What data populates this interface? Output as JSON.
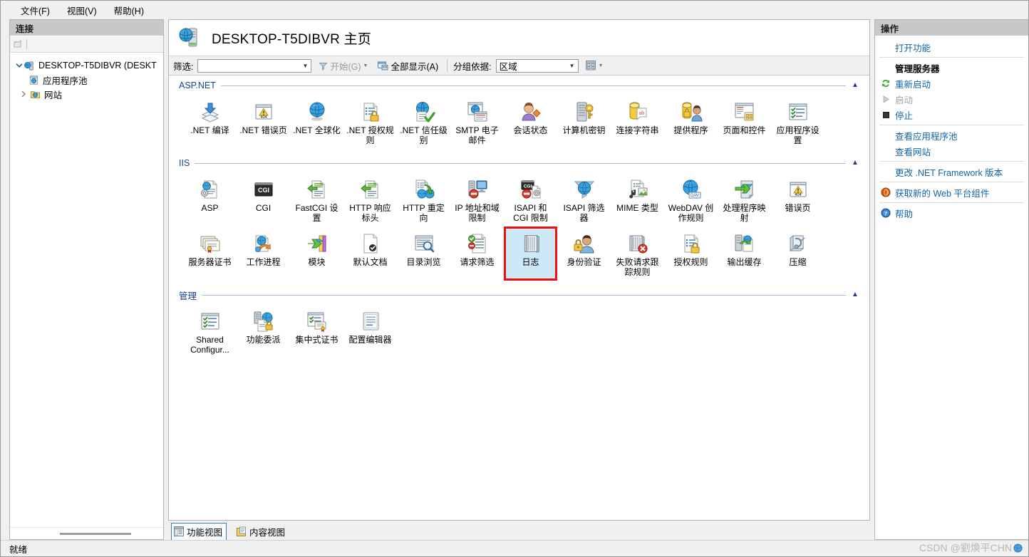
{
  "menubar": {
    "items": [
      {
        "label": "文件(F)",
        "name": "menu-file"
      },
      {
        "label": "视图(V)",
        "name": "menu-view"
      },
      {
        "label": "帮助(H)",
        "name": "menu-help"
      }
    ]
  },
  "connections": {
    "header": "连接",
    "tree": [
      {
        "label": "DESKTOP-T5DIBVR (DESKT",
        "level": 0,
        "expanded": true,
        "icon": "server-icon"
      },
      {
        "label": "应用程序池",
        "level": 1,
        "expanded": null,
        "icon": "app-pool-icon"
      },
      {
        "label": "网站",
        "level": 1,
        "expanded": false,
        "icon": "sites-folder-icon"
      }
    ]
  },
  "header": {
    "title": "DESKTOP-T5DIBVR 主页",
    "icon": "server-home-icon"
  },
  "toolbar": {
    "filter_label": "筛选:",
    "filter_value": "",
    "start_label": "开始(G)",
    "show_all_label": "全部显示(A)",
    "group_by_label": "分组依据:",
    "group_by_value": "区域",
    "view_mode_icon": "details-view-icon"
  },
  "groups": [
    {
      "name": "ASP.NET",
      "tiles": [
        {
          "label": ".NET 编译",
          "icon": "net-compilation-icon"
        },
        {
          "label": ".NET 错误页",
          "icon": "net-error-pages-icon"
        },
        {
          "label": ".NET 全球化",
          "icon": "net-globalization-icon"
        },
        {
          "label": ".NET 授权规则",
          "icon": "net-authorization-rules-icon"
        },
        {
          "label": ".NET 信任级别",
          "icon": "net-trust-levels-icon"
        },
        {
          "label": "SMTP 电子邮件",
          "icon": "smtp-email-icon"
        },
        {
          "label": "会话状态",
          "icon": "session-state-icon"
        },
        {
          "label": "计算机密钥",
          "icon": "machine-key-icon"
        },
        {
          "label": "连接字符串",
          "icon": "connection-strings-icon"
        },
        {
          "label": "提供程序",
          "icon": "providers-icon"
        },
        {
          "label": "页面和控件",
          "icon": "pages-and-controls-icon"
        },
        {
          "label": "应用程序设置",
          "icon": "application-settings-icon"
        }
      ]
    },
    {
      "name": "IIS",
      "tiles": [
        {
          "label": "ASP",
          "icon": "asp-icon"
        },
        {
          "label": "CGI",
          "icon": "cgi-icon"
        },
        {
          "label": "FastCGI 设置",
          "icon": "fastcgi-settings-icon"
        },
        {
          "label": "HTTP 响应标头",
          "icon": "http-response-headers-icon"
        },
        {
          "label": "HTTP 重定向",
          "icon": "http-redirect-icon"
        },
        {
          "label": "IP 地址和域限制",
          "icon": "ip-address-domain-restrictions-icon"
        },
        {
          "label": "ISAPI 和 CGI 限制",
          "icon": "isapi-cgi-restrictions-icon"
        },
        {
          "label": "ISAPI 筛选器",
          "icon": "isapi-filters-icon"
        },
        {
          "label": "MIME 类型",
          "icon": "mime-types-icon"
        },
        {
          "label": "WebDAV 创作规则",
          "icon": "webdav-authoring-rules-icon"
        },
        {
          "label": "处理程序映射",
          "icon": "handler-mappings-icon"
        },
        {
          "label": "错误页",
          "icon": "error-pages-icon"
        },
        {
          "label": "服务器证书",
          "icon": "server-certificates-icon"
        },
        {
          "label": "工作进程",
          "icon": "worker-processes-icon"
        },
        {
          "label": "模块",
          "icon": "modules-icon"
        },
        {
          "label": "默认文档",
          "icon": "default-document-icon"
        },
        {
          "label": "目录浏览",
          "icon": "directory-browsing-icon"
        },
        {
          "label": "请求筛选",
          "icon": "request-filtering-icon"
        },
        {
          "label": "日志",
          "icon": "logging-icon",
          "selected": true
        },
        {
          "label": "身份验证",
          "icon": "authentication-icon"
        },
        {
          "label": "失败请求跟踪规则",
          "icon": "failed-request-tracing-rules-icon"
        },
        {
          "label": "授权规则",
          "icon": "authorization-rules-icon"
        },
        {
          "label": "输出缓存",
          "icon": "output-caching-icon"
        },
        {
          "label": "压缩",
          "icon": "compression-icon"
        }
      ]
    },
    {
      "name": "管理",
      "tiles": [
        {
          "label": "Shared Configur...",
          "icon": "shared-configuration-icon"
        },
        {
          "label": "功能委派",
          "icon": "feature-delegation-icon"
        },
        {
          "label": "集中式证书",
          "icon": "centralized-certificates-icon"
        },
        {
          "label": "配置编辑器",
          "icon": "configuration-editor-icon"
        }
      ]
    }
  ],
  "view_tabs": [
    {
      "label": "功能视图",
      "icon": "features-view-icon",
      "active": true
    },
    {
      "label": "内容视图",
      "icon": "content-view-icon",
      "active": false
    }
  ],
  "actions": {
    "header": "操作",
    "items": [
      {
        "label": "打开功能",
        "style": "link",
        "indent": true,
        "icon": null,
        "name": "action-open-feature"
      },
      {
        "separator": true
      },
      {
        "label": "管理服务器",
        "style": "bold",
        "indent": true,
        "icon": null,
        "name": "action-manage-server"
      },
      {
        "label": "重新启动",
        "style": "link",
        "icon": "restart-icon",
        "name": "action-restart"
      },
      {
        "label": "启动",
        "style": "disabled",
        "icon": "start-icon",
        "name": "action-start"
      },
      {
        "label": "停止",
        "style": "link",
        "icon": "stop-icon",
        "name": "action-stop"
      },
      {
        "separator": true
      },
      {
        "label": "查看应用程序池",
        "style": "link",
        "indent": true,
        "icon": null,
        "name": "action-view-app-pools"
      },
      {
        "label": "查看网站",
        "style": "link",
        "indent": true,
        "icon": null,
        "name": "action-view-sites"
      },
      {
        "separator": true
      },
      {
        "label": "更改 .NET Framework 版本",
        "style": "link",
        "indent": true,
        "icon": null,
        "name": "action-change-dotnet-version"
      },
      {
        "separator": true
      },
      {
        "label": "获取新的 Web 平台组件",
        "style": "link",
        "icon": "web-platform-icon",
        "name": "action-get-web-platform"
      },
      {
        "separator": true
      },
      {
        "label": "帮助",
        "style": "link",
        "icon": "help-icon",
        "name": "action-help"
      }
    ]
  },
  "statusbar": {
    "text": "就绪",
    "watermark": "CSDN @劉煥平CHN"
  },
  "colors": {
    "link": "#1264a3",
    "group_title": "#15428b",
    "selection_border": "#ee1111",
    "selection_bg": "#cde8f6",
    "pane_header_bg": "#c8c8c8"
  }
}
